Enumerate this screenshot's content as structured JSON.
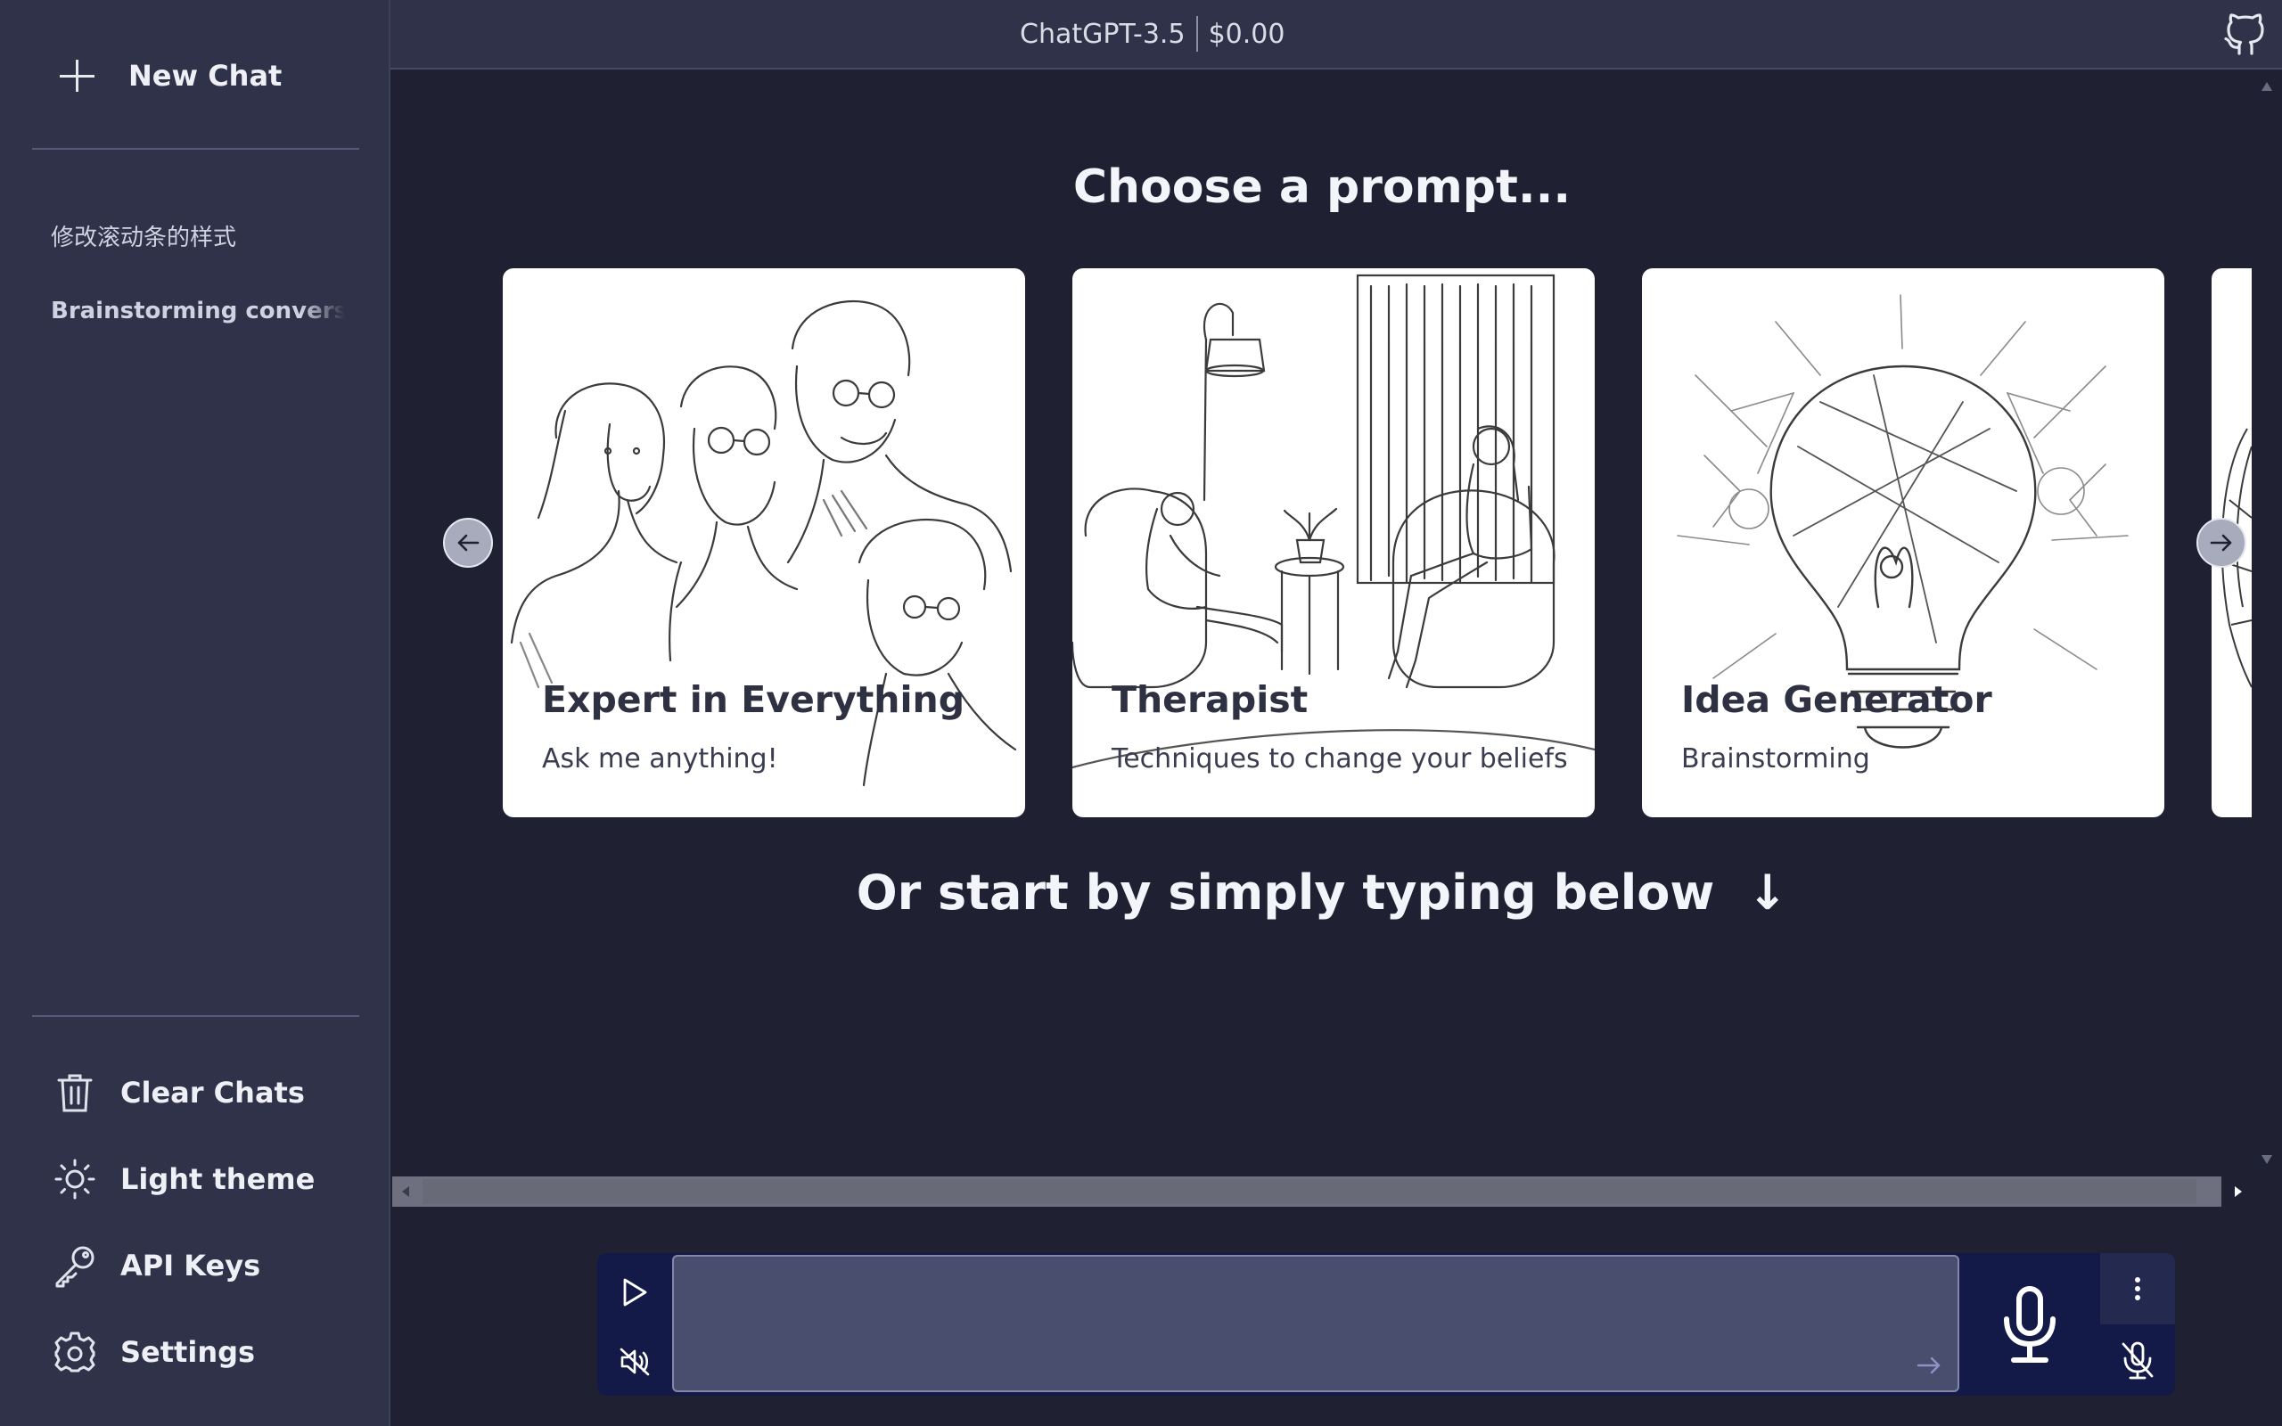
{
  "sidebar": {
    "new_chat_label": "New Chat",
    "history": [
      {
        "title": "修改滚动条的样式"
      },
      {
        "title": "Brainstorming conversation"
      }
    ],
    "actions": {
      "clear": "Clear Chats",
      "theme": "Light theme",
      "api_keys": "API Keys",
      "settings": "Settings"
    }
  },
  "header": {
    "model": "ChatGPT-3.5",
    "cost": "$0.00",
    "github_icon": "github-icon"
  },
  "main": {
    "choose_heading": "Choose a prompt...",
    "cards": [
      {
        "title": "Expert in Everything",
        "subtitle": "Ask me anything!"
      },
      {
        "title": "Therapist",
        "subtitle": "Techniques to change your beliefs"
      },
      {
        "title": "Idea Generator",
        "subtitle": "Brainstorming"
      }
    ],
    "start_heading": "Or start by simply typing below",
    "start_arrow": "↓"
  },
  "composer": {
    "input_value": "",
    "input_placeholder": ""
  },
  "colors": {
    "background": "#1f2133",
    "sidebar": "#2f3248",
    "composer": "#141a48",
    "input": "#4a4e6e"
  }
}
